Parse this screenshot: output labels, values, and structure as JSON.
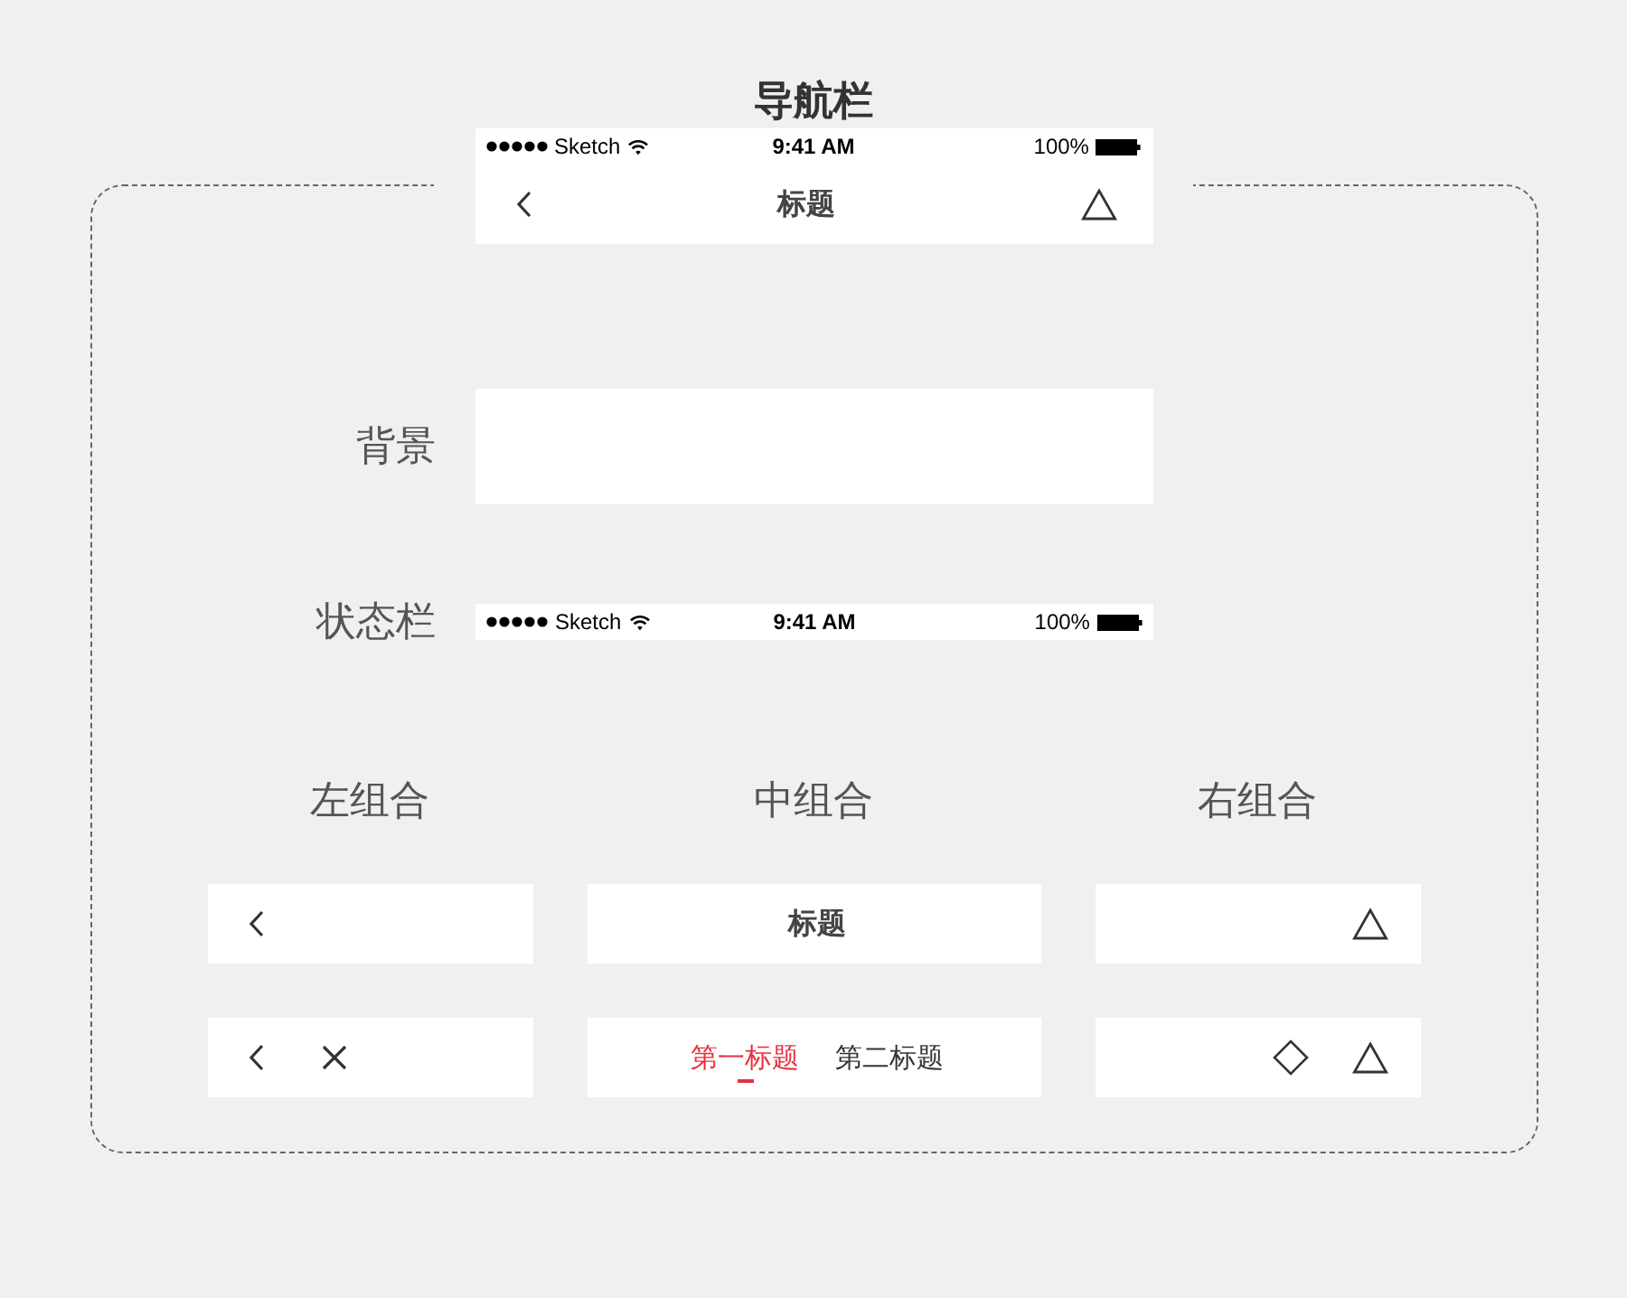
{
  "title": "导航栏",
  "preview": {
    "status_bar": {
      "carrier": "Sketch",
      "time": "9:41 AM",
      "battery": "100%"
    },
    "nav_title": "标题"
  },
  "rows": [
    {
      "label": "背景",
      "kind": "background"
    },
    {
      "label": "状态栏",
      "kind": "status_bar",
      "status_bar": {
        "carrier": "Sketch",
        "time": "9:41 AM",
        "battery": "100%"
      }
    }
  ],
  "groups": [
    {
      "heading": "左组合",
      "kind": "left",
      "bars": [
        {
          "items": [
            {
              "kind": "back"
            }
          ]
        },
        {
          "items": [
            {
              "kind": "back"
            },
            {
              "kind": "close"
            }
          ]
        }
      ]
    },
    {
      "heading": "中组合",
      "kind": "center",
      "bars": [
        {
          "items": [
            {
              "kind": "title",
              "text": "标题"
            }
          ]
        },
        {
          "items": [
            {
              "kind": "tab",
              "text": "第一标题",
              "selected": true
            },
            {
              "kind": "tab",
              "text": "第二标题",
              "selected": false
            }
          ]
        }
      ]
    },
    {
      "heading": "右组合",
      "kind": "right",
      "bars": [
        {
          "items": [
            {
              "kind": "triangle"
            }
          ]
        },
        {
          "items": [
            {
              "kind": "diamond"
            },
            {
              "kind": "triangle"
            }
          ]
        }
      ]
    }
  ]
}
